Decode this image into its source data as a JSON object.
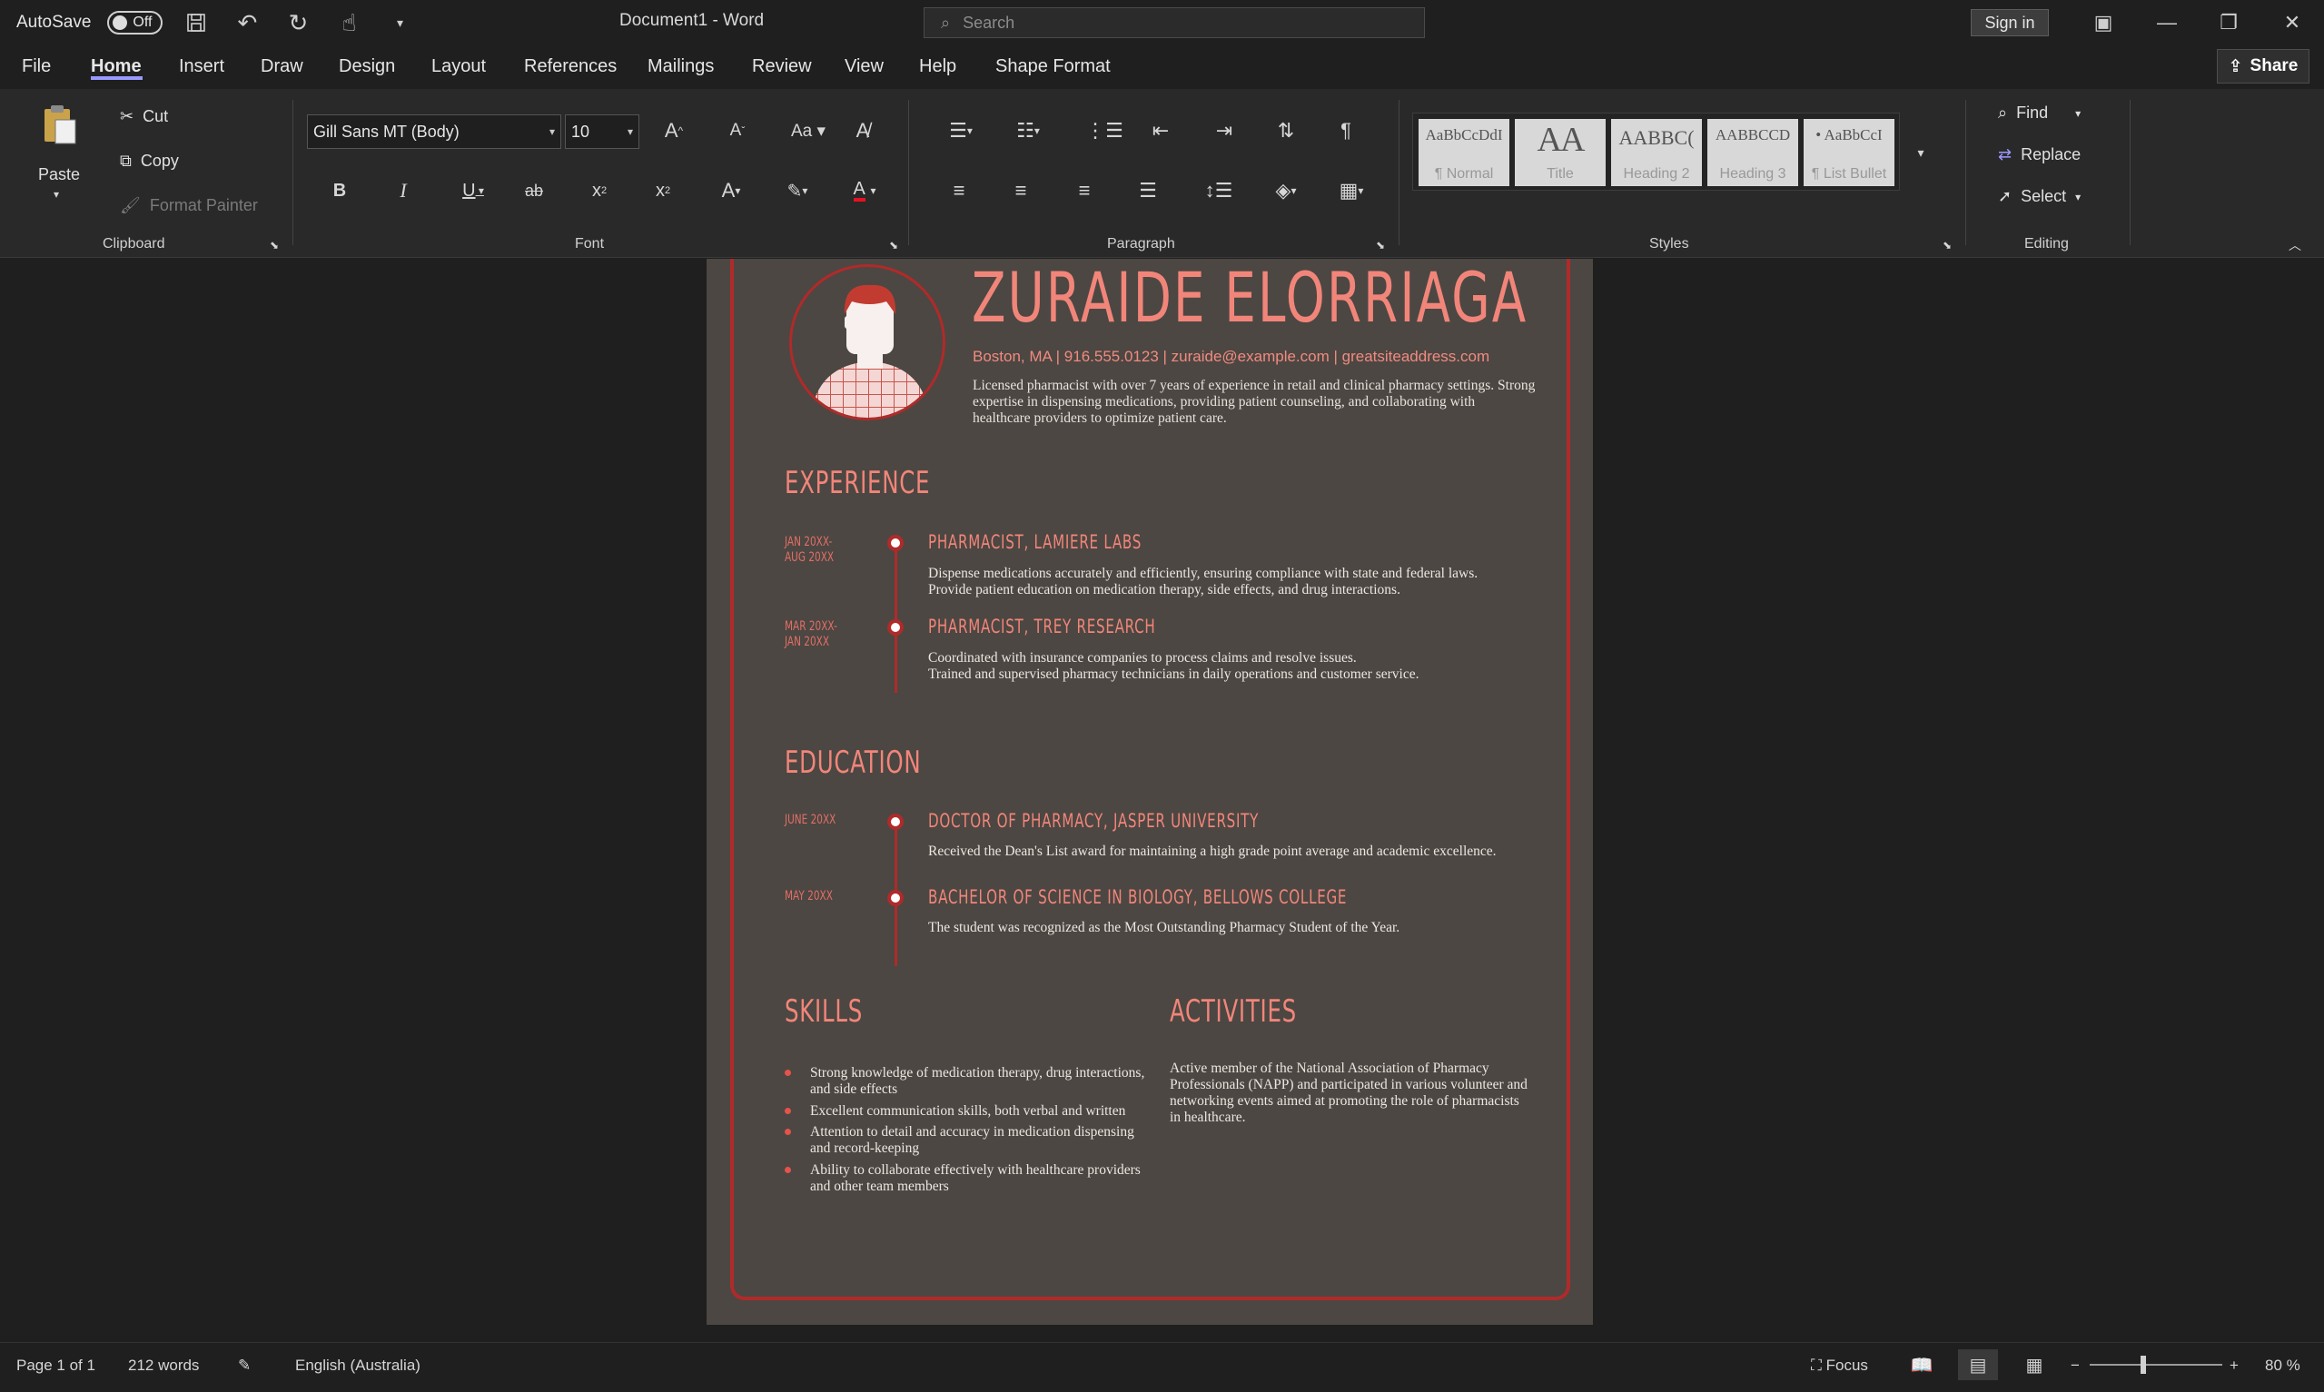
{
  "titlebar": {
    "autosave_label": "AutoSave",
    "autosave_state": "Off",
    "document_title": "Document1  -  Word",
    "search_placeholder": "Search",
    "signin_label": "Sign in"
  },
  "menu": {
    "tabs": [
      "File",
      "Home",
      "Insert",
      "Draw",
      "Design",
      "Layout",
      "References",
      "Mailings",
      "Review",
      "View",
      "Help",
      "Shape Format"
    ],
    "active_tab": "Home",
    "share_label": "Share"
  },
  "ribbon": {
    "clipboard": {
      "paste_label": "Paste",
      "cut_label": "Cut",
      "copy_label": "Copy",
      "format_painter_label": "Format Painter",
      "group_label": "Clipboard"
    },
    "font": {
      "font_name": "Gill Sans MT (Body)",
      "font_size": "10",
      "group_label": "Font"
    },
    "paragraph": {
      "group_label": "Paragraph"
    },
    "styles": {
      "items": [
        {
          "preview": "AaBbCcDdI",
          "name": "¶ Normal"
        },
        {
          "preview": "AA",
          "name": "Title"
        },
        {
          "preview": "AABBC(",
          "name": "Heading 2"
        },
        {
          "preview": "AABBCCD",
          "name": "Heading 3"
        },
        {
          "preview": "• AaBbCcI",
          "name": "¶ List Bullet"
        }
      ],
      "group_label": "Styles"
    },
    "editing": {
      "find_label": "Find",
      "replace_label": "Replace",
      "select_label": "Select",
      "group_label": "Editing"
    }
  },
  "resume": {
    "name": "ZURAIDE ELORRIAGA",
    "contact": "Boston, MA | 916.555.0123 | zuraide@example.com | greatsiteaddress.com",
    "summary": "Licensed pharmacist with over 7 years of experience in retail and clinical pharmacy settings. Strong expertise in dispensing medications, providing patient counseling, and collaborating with healthcare providers to optimize patient care.",
    "experience_heading": "EXPERIENCE",
    "experience": [
      {
        "date1": "JAN 20XX-",
        "date2": "AUG 20XX",
        "title": "PHARMACIST, LAMIERE LABS",
        "line1": "Dispense medications accurately and efficiently, ensuring compliance with state and federal laws.",
        "line2": "Provide patient education on medication therapy, side effects, and drug interactions."
      },
      {
        "date1": "MAR 20XX-",
        "date2": "JAN 20XX",
        "title": "PHARMACIST, TREY RESEARCH",
        "line1": "Coordinated with insurance companies to process claims and resolve issues.",
        "line2": "Trained and supervised pharmacy technicians in daily operations and customer service."
      }
    ],
    "education_heading": "EDUCATION",
    "education": [
      {
        "date": "JUNE 20XX",
        "title": "DOCTOR OF PHARMACY, JASPER UNIVERSITY",
        "line1": "Received the Dean's List award for maintaining a high grade point average and academic excellence."
      },
      {
        "date": "MAY 20XX",
        "title": "BACHELOR OF SCIENCE IN BIOLOGY, BELLOWS COLLEGE",
        "line1": "The student was recognized as the Most Outstanding Pharmacy Student of the Year."
      }
    ],
    "skills_heading": "SKILLS",
    "skills": [
      "Strong knowledge of medication therapy, drug interactions, and side effects",
      "Excellent communication skills, both verbal and written",
      "Attention to detail and accuracy in medication dispensing and record-keeping",
      "Ability to collaborate effectively with healthcare providers and other team members"
    ],
    "activities_heading": "ACTIVITIES",
    "activities": "Active member of the National Association of Pharmacy Professionals (NAPP) and participated in various volunteer and networking events aimed at promoting the role of pharmacists in healthcare."
  },
  "statusbar": {
    "page_info": "Page 1 of 1",
    "word_count": "212 words",
    "language": "English (Australia)",
    "focus_label": "Focus",
    "zoom_level": "80 %"
  },
  "colors": {
    "accent": "#f2857a",
    "border_red": "#b02a2a",
    "page_bg": "#4c4742",
    "app_bg": "#1f1f1f"
  }
}
